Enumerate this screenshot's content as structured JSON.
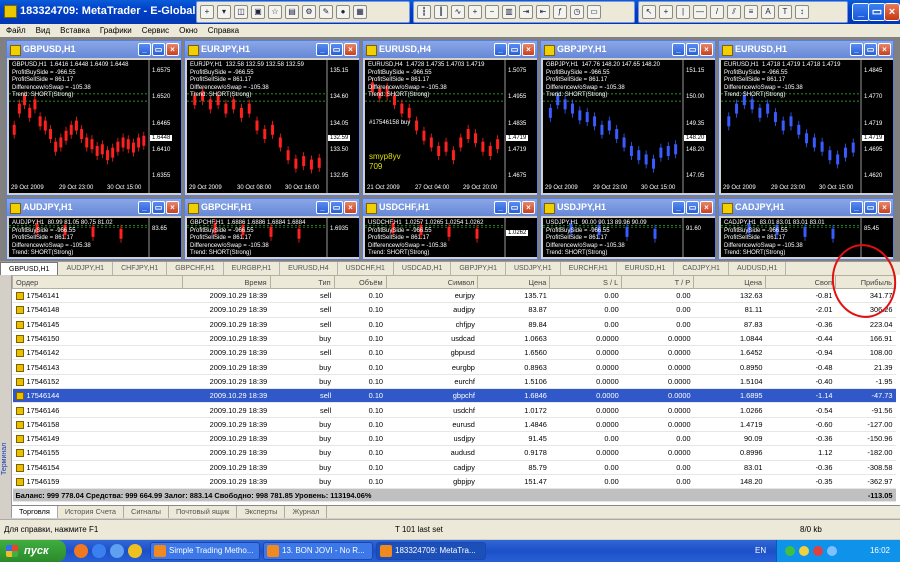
{
  "window": {
    "title": "183324709: MetaTrader - E-Global Trad"
  },
  "menu": [
    "Файл",
    "Вид",
    "Вставка",
    "Графики",
    "Сервис",
    "Окно",
    "Справка"
  ],
  "charts": [
    {
      "title": "GBPUSD,H1",
      "info": [
        "GBPUSD,H1  1.6416 1.6448 1.6409 1.6448",
        "ProfitBuySide = -966.55",
        "ProfitSellSide = 861.17",
        "Differencew/oSwap = -105.38",
        "Trend: SHORT(Strong)"
      ],
      "prices": [
        "1.6575",
        "1.6520",
        "1.6465",
        "1.6410",
        "1.6355"
      ],
      "current": "1.6448",
      "dates": [
        "29 Oct 2009",
        "29 Oct 23:00",
        "30 Oct 15:00"
      ],
      "color": "#ff2020",
      "trend": [
        0.55,
        0.3,
        0.2,
        0.35,
        0.25,
        0.45,
        0.5,
        0.6,
        0.75,
        0.7,
        0.62,
        0.55,
        0.5,
        0.6,
        0.7,
        0.72,
        0.8,
        0.78,
        0.85,
        0.82,
        0.75,
        0.7,
        0.72,
        0.76,
        0.7,
        0.68
      ]
    },
    {
      "title": "EURJPY,H1",
      "info": [
        "EURJPY,H1  132.58 132.59 132.58 132.59",
        "ProfitBuySide = -966.55",
        "ProfitSellSide = 861.17",
        "Differencew/oSwap = -105.38",
        "Trend: SHORT(Strong)"
      ],
      "prices": [
        "135.15",
        "134.60",
        "134.05",
        "133.50",
        "132.95"
      ],
      "current": "132.59",
      "dates": [
        "29 Oct 2009",
        "30 Oct 08:00",
        "30 Oct 16:00"
      ],
      "color": "#ff2020",
      "trend": [
        0.2,
        0.15,
        0.25,
        0.2,
        0.3,
        0.25,
        0.35,
        0.3,
        0.5,
        0.6,
        0.55,
        0.7,
        0.85,
        0.95,
        0.92,
        0.96,
        0.94
      ]
    },
    {
      "title": "EURUSD,H4",
      "info": [
        "EURUSD,H4  1.4728 1.4735 1.4703 1.4719",
        "ProfitBuySide = -966.55",
        "ProfitSellSide = 861.17",
        "Differencew/oSwap = -105.38",
        "Trend: SHORT(Strong)"
      ],
      "prices": [
        "1.5075",
        "1.4955",
        "1.4835",
        "1.4719",
        "1.4675"
      ],
      "current": "1.4719",
      "dates": [
        "21 Oct 2009",
        "27 Oct 04:00",
        "29 Oct 20:00"
      ],
      "color": "#ff2020",
      "trend": [
        0.05,
        0.12,
        0.1,
        0.2,
        0.3,
        0.35,
        0.5,
        0.62,
        0.7,
        0.8,
        0.75,
        0.85,
        0.7,
        0.6,
        0.65,
        0.75,
        0.8,
        0.72
      ],
      "extra": [
        "#17546158 buy",
        "smyp8yv",
        "709"
      ]
    },
    {
      "title": "GBPJPY,H1",
      "info": [
        "GBPJPY,H1  147.76 148.20 147.65 148.20",
        "ProfitBuySide = -966.55",
        "ProfitSellSide = 861.17",
        "Differencew/oSwap = -105.38",
        "Trend: SHORT(Strong)"
      ],
      "prices": [
        "151.15",
        "150.00",
        "149.35",
        "148.20",
        "147.05"
      ],
      "current": "148.20",
      "dates": [
        "29 Oct 2009",
        "29 Oct 23:00",
        "30 Oct 15:00"
      ],
      "color": "#3a5cff",
      "trend": [
        0.35,
        0.2,
        0.25,
        0.3,
        0.38,
        0.4,
        0.45,
        0.55,
        0.5,
        0.6,
        0.7,
        0.8,
        0.85,
        0.9,
        0.95,
        0.82,
        0.8,
        0.78
      ]
    },
    {
      "title": "EURUSD,H1",
      "info": [
        "EURUSD,H1  1.4718 1.4719 1.4718 1.4719",
        "ProfitBuySide = -966.55",
        "ProfitSellSide = 861.17",
        "Differencew/oSwap = -105.38",
        "Trend: SHORT(Strong)"
      ],
      "prices": [
        "1.4845",
        "1.4770",
        "1.4719",
        "1.4695",
        "1.4620"
      ],
      "current": "1.4719",
      "dates": [
        "29 Oct 2009",
        "29 Oct 23:00",
        "30 Oct 15:00"
      ],
      "color": "#3a5cff",
      "trend": [
        0.45,
        0.3,
        0.2,
        0.25,
        0.35,
        0.3,
        0.4,
        0.5,
        0.45,
        0.55,
        0.65,
        0.7,
        0.75,
        0.85,
        0.9,
        0.82,
        0.76
      ]
    },
    {
      "title": "AUDJPY,H1",
      "info": [
        "AUDJPY,H1  80.99 81.05 80.75 81.02",
        "ProfitBuySide = -966.55",
        "ProfitSellSide = 861.17",
        "Differencew/oSwap = -105.38",
        "Trend: SHORT(Strong)"
      ],
      "prices": [
        "83.65"
      ],
      "current": "",
      "dates": [],
      "color": "#ff2020",
      "trend": [
        0.3,
        0.4,
        0.5,
        0.6
      ]
    },
    {
      "title": "GBPCHF,H1",
      "info": [
        "GBPCHF,H1  1.6886 1.6886 1.6884 1.6884",
        "ProfitBuySide = -966.55",
        "ProfitSellSide = 861.17",
        "Differencew/oSwap = -105.38",
        "Trend: SHORT(Strong)"
      ],
      "prices": [
        "1.6935"
      ],
      "current": "",
      "dates": [],
      "color": "#ff2020",
      "trend": [
        0.3,
        0.4,
        0.5,
        0.6
      ]
    },
    {
      "title": "USDCHF,H1",
      "info": [
        "USDCHF,H1  1.0257 1.0265 1.0254 1.0262",
        "ProfitBuySide = -966.55",
        "ProfitSellSide = 861.17",
        "Differencew/oSwap = -105.38",
        "Trend: SHORT(Strong)"
      ],
      "prices": [],
      "current": "1.0262",
      "dates": [],
      "color": "#ff2020",
      "trend": [
        0.3,
        0.4,
        0.5,
        0.6
      ]
    },
    {
      "title": "USDJPY,H1",
      "info": [
        "USDJPY,H1  90.00 90.13 89.96 90.09",
        "ProfitBuySide = -966.55",
        "ProfitSellSide = 861.17",
        "Differencew/oSwap = -105.38",
        "Trend: SHORT(Strong)"
      ],
      "prices": [
        "91.60"
      ],
      "current": "",
      "dates": [],
      "color": "#3a5cff",
      "trend": [
        0.3,
        0.4,
        0.5,
        0.6
      ]
    },
    {
      "title": "CADJPY,H1",
      "info": [
        "CADJPY,H1  83.01 83.01 83.01 83.01",
        "ProfitBuySide = -966.55",
        "ProfitSellSide = 861.17",
        "Differencew/oSwap = -105.38",
        "Trend: SHORT(Strong)"
      ],
      "prices": [
        "85.45"
      ],
      "current": "",
      "dates": [],
      "color": "#3a5cff",
      "trend": [
        0.3,
        0.4,
        0.5,
        0.6
      ]
    }
  ],
  "chart_tabs": [
    "GBPUSD,H1",
    "AUDJPY,H1",
    "CHFJPY,H1",
    "GBPCHF,H1",
    "EURGBP,H1",
    "EURUSD,H4",
    "USDCHF,H1",
    "USDCAD,H1",
    "GBPJPY,H1",
    "USDJPY,H1",
    "EURCHF,H1",
    "EURUSD,H1",
    "CADJPY,H1",
    "AUDUSD,H1"
  ],
  "table": {
    "headers": [
      "Ордер",
      "Время",
      "Тип",
      "Объём",
      "Символ",
      "Цена",
      "S / L",
      "T / P",
      "Цена",
      "Своп",
      "Прибыль"
    ],
    "rows": [
      [
        "17546141",
        "2009.10.29 18:39",
        "sell",
        "0.10",
        "eurjpy",
        "135.71",
        "0.00",
        "0.00",
        "132.63",
        "-0.81",
        "341.77"
      ],
      [
        "17546148",
        "2009.10.29 18:39",
        "sell",
        "0.10",
        "audjpy",
        "83.87",
        "0.00",
        "0.00",
        "81.11",
        "-2.01",
        "306.26"
      ],
      [
        "17546145",
        "2009.10.29 18:39",
        "sell",
        "0.10",
        "chfjpy",
        "89.84",
        "0.00",
        "0.00",
        "87.83",
        "-0.36",
        "223.04"
      ],
      [
        "17546150",
        "2009.10.29 18:39",
        "buy",
        "0.10",
        "usdcad",
        "1.0663",
        "0.0000",
        "0.0000",
        "1.0844",
        "-0.44",
        "166.91"
      ],
      [
        "17546142",
        "2009.10.29 18:39",
        "sell",
        "0.10",
        "gbpusd",
        "1.6560",
        "0.0000",
        "0.0000",
        "1.6452",
        "-0.94",
        "108.00"
      ],
      [
        "17546143",
        "2009.10.29 18:39",
        "buy",
        "0.10",
        "eurgbp",
        "0.8963",
        "0.0000",
        "0.0000",
        "0.8950",
        "-0.48",
        "21.39"
      ],
      [
        "17546152",
        "2009.10.29 18:39",
        "buy",
        "0.10",
        "eurchf",
        "1.5106",
        "0.0000",
        "0.0000",
        "1.5104",
        "-0.40",
        "-1.95"
      ],
      [
        "17546144",
        "2009.10.29 18:39",
        "sell",
        "0.10",
        "gbpchf",
        "1.6846",
        "0.0000",
        "0.0000",
        "1.6895",
        "-1.14",
        "-47.73"
      ],
      [
        "17546146",
        "2009.10.29 18:39",
        "sell",
        "0.10",
        "usdchf",
        "1.0172",
        "0.0000",
        "0.0000",
        "1.0266",
        "-0.54",
        "-91.56"
      ],
      [
        "17546158",
        "2009.10.29 18:39",
        "buy",
        "0.10",
        "eurusd",
        "1.4846",
        "0.0000",
        "0.0000",
        "1.4719",
        "-0.60",
        "-127.00"
      ],
      [
        "17546149",
        "2009.10.29 18:39",
        "buy",
        "0.10",
        "usdjpy",
        "91.45",
        "0.00",
        "0.00",
        "90.09",
        "-0.36",
        "-150.96"
      ],
      [
        "17546155",
        "2009.10.29 18:39",
        "buy",
        "0.10",
        "audusd",
        "0.9178",
        "0.0000",
        "0.0000",
        "0.8996",
        "1.12",
        "-182.00"
      ],
      [
        "17546154",
        "2009.10.29 18:39",
        "buy",
        "0.10",
        "cadjpy",
        "85.79",
        "0.00",
        "0.00",
        "83.01",
        "-0.36",
        "-308.58"
      ],
      [
        "17546159",
        "2009.10.29 18:39",
        "buy",
        "0.10",
        "gbpjpy",
        "151.47",
        "0.00",
        "0.00",
        "148.20",
        "-0.35",
        "-362.97"
      ]
    ],
    "selected_index": 7,
    "summary": "Баланс: 999 778.04  Средства: 999 664.99  Залог: 883.14  Свободно: 998 781.85  Уровень: 113194.06%",
    "summary_total": "-113.05"
  },
  "terminal": {
    "vertical_label": "Терминал",
    "tabs": [
      "Торговля",
      "История Счета",
      "Сигналы",
      "Почтовый ящик",
      "Эксперты",
      "Журнал"
    ]
  },
  "status": {
    "help": "Для справки, нажмите F1",
    "center": "T 101 last set",
    "right": "8/0 kb"
  },
  "taskbar": {
    "start": "пуск",
    "tasks": [
      "Simple Trading Metho...",
      "13. BON JOVI - No R...",
      "183324709: MetaTra..."
    ],
    "lang": "EN",
    "clock": "16:02"
  }
}
